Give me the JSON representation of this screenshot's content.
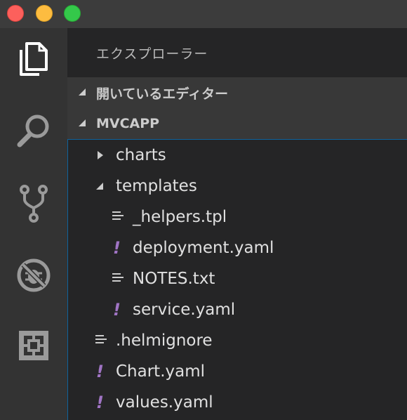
{
  "window": {
    "buttons": [
      "close",
      "minimize",
      "maximize"
    ]
  },
  "activity_bar": {
    "items": [
      {
        "name": "explorer",
        "icon": "files-icon",
        "active": true
      },
      {
        "name": "search",
        "icon": "search-icon",
        "active": false
      },
      {
        "name": "source-control",
        "icon": "git-branch-icon",
        "active": false
      },
      {
        "name": "debug",
        "icon": "no-bug-icon",
        "active": false
      },
      {
        "name": "extensions",
        "icon": "extensions-icon",
        "active": false
      }
    ]
  },
  "sidebar": {
    "title": "エクスプローラー",
    "open_editors_label": "開いているエディター",
    "project_label": "MVCAPP",
    "tree": [
      {
        "label": "charts",
        "type": "folder",
        "expanded": false,
        "depth": 0,
        "icon": "chevron-right-icon"
      },
      {
        "label": "templates",
        "type": "folder",
        "expanded": true,
        "depth": 0,
        "icon": "chevron-down-icon"
      },
      {
        "label": "_helpers.tpl",
        "type": "file",
        "depth": 1,
        "icon": "text-file-icon"
      },
      {
        "label": "deployment.yaml",
        "type": "file",
        "depth": 1,
        "icon": "yaml-file-icon"
      },
      {
        "label": "NOTES.txt",
        "type": "file",
        "depth": 1,
        "icon": "text-file-icon"
      },
      {
        "label": "service.yaml",
        "type": "file",
        "depth": 1,
        "icon": "yaml-file-icon"
      },
      {
        "label": ".helmignore",
        "type": "file",
        "depth": 0,
        "icon": "text-file-icon"
      },
      {
        "label": "Chart.yaml",
        "type": "file",
        "depth": 0,
        "icon": "yaml-file-icon"
      },
      {
        "label": "values.yaml",
        "type": "file",
        "depth": 0,
        "icon": "yaml-file-icon"
      }
    ]
  },
  "colors": {
    "titlebar": "#3c3c3c",
    "activity_bar": "#333333",
    "sidebar": "#252526",
    "section_header": "#383838",
    "yaml_icon": "#a074c4",
    "focus_border": "#0e639c"
  }
}
